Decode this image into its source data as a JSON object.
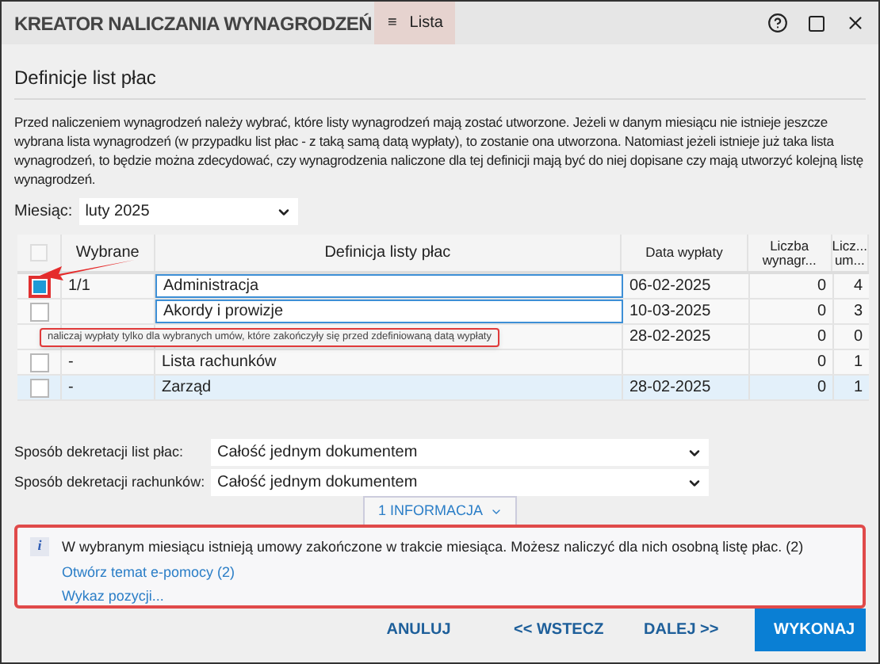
{
  "window": {
    "title": "KREATOR NALICZANIA WYNAGRODZEŃ",
    "menu": {
      "icon": "≡",
      "label": "Lista"
    }
  },
  "section_title": "Definicje list płac",
  "description": "Przed naliczeniem wynagrodzeń należy wybrać, które listy wynagrodzeń mają zostać utworzone. Jeżeli w danym miesiącu nie istnieje jeszcze wybrana lista wynagrodzeń (w przypadku list płac - z taką samą datą wypłaty), to zostanie ona utworzona. Natomiast jeżeli istnieje już taka lista wynagrodzeń, to będzie można zdecydować, czy wynagrodzenia naliczone dla tej definicji mają być do niej dopisane czy mają utworzyć kolejną listę wynagrodzeń.",
  "month": {
    "label": "Miesiąc:",
    "value": "luty 2025"
  },
  "table": {
    "select_all": {
      "checked": false
    },
    "columns": [
      "Wybrane",
      "Definicja listy płac",
      "Data wypłaty",
      "Liczba wynagr...",
      "Licz... um..."
    ],
    "rows": [
      {
        "checked": true,
        "chosen": "1/1",
        "name": "Administracja",
        "date": "06-02-2025",
        "count_1": "0",
        "count_2": "4",
        "focused": true,
        "selected": false
      },
      {
        "checked": false,
        "name": "Akordy i prowizje",
        "date": "10-03-2025",
        "count_1": "0",
        "count_2": "3",
        "focused": true,
        "selected": false
      },
      {
        "date": "28-02-2025",
        "count_1": "0",
        "count_2": "0",
        "focused": false,
        "selected": false
      },
      {
        "checked": false,
        "chosen": "-",
        "name": "Lista rachunków",
        "count_1": "0",
        "count_2": "1",
        "focused": false,
        "selected": false
      },
      {
        "checked": false,
        "chosen": "-",
        "name": "Zarząd",
        "date": "28-02-2025",
        "count_1": "0",
        "count_2": "1",
        "focused": false,
        "selected": true
      }
    ]
  },
  "tooltip": "naliczaj wypłaty tylko dla wybranych umów, które zakończyły się przed zdefiniowaną datą wypłaty",
  "decrees": [
    {
      "label": "Sposób dekretacji list płac:",
      "value": "Całość jednym dokumentem"
    },
    {
      "label": "Sposób dekretacji rachunków:",
      "value": "Całość jednym dokumentem"
    }
  ],
  "info_toggle": "1 INFORMACJA",
  "info": {
    "icon": "i",
    "message": "W wybranym miesiącu istnieją umowy zakończone w trakcie miesiąca. Możesz naliczyć dla nich osobną listę płac. (2)",
    "links": [
      "Otwórz temat e-pomocy (2)",
      "Wykaz pozycji..."
    ]
  },
  "buttons": [
    {
      "label": "ANULUJ",
      "primary": false
    },
    {
      "label": "<< WSTECZ",
      "primary": false
    },
    {
      "label": "DALEJ >>",
      "primary": false
    },
    {
      "label": "WYKONAJ",
      "primary": true
    }
  ]
}
